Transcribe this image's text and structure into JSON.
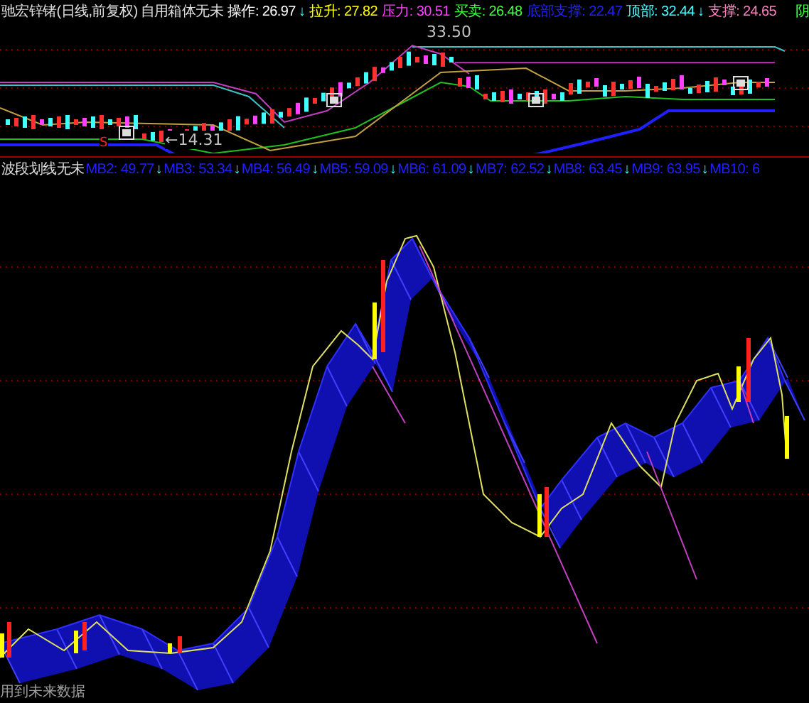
{
  "main_header": {
    "title": "驰宏锌锗(日线,前复权)",
    "formula": "自用箱体无未",
    "items": [
      {
        "label": "操作:",
        "value": "26.97",
        "color": "#ffffff",
        "arrow": "↓"
      },
      {
        "label": "拉升:",
        "value": "27.82",
        "color": "#ffff00"
      },
      {
        "label": "压力:",
        "value": "30.51",
        "color": "#ff40ff"
      },
      {
        "label": "买卖:",
        "value": "26.48",
        "color": "#40ff40"
      },
      {
        "label": "底部支撑:",
        "value": "22.47",
        "color": "#2020ff"
      },
      {
        "label": "顶部:",
        "value": "32.44",
        "color": "#40ffff",
        "arrow": "↓"
      },
      {
        "label": "支撑:",
        "value": "24.65",
        "color": "#ff80c0"
      }
    ],
    "tail": "阴"
  },
  "main_chart": {
    "high_label": "33.50",
    "low_label": "←14.31",
    "signal_mark": "S"
  },
  "indicator_header": {
    "title": "波段划线无未",
    "items": [
      {
        "text": "MB2: 49.77",
        "arrow": "↓"
      },
      {
        "text": "MB3: 53.34",
        "arrow": "↓"
      },
      {
        "text": "MB4: 56.49",
        "arrow": "↓"
      },
      {
        "text": "MB5: 59.09",
        "arrow": "↓"
      },
      {
        "text": "MB6: 61.09",
        "arrow": "↓"
      },
      {
        "text": "MB7: 62.52",
        "arrow": "↓"
      },
      {
        "text": "MB8: 63.45",
        "arrow": "↓"
      },
      {
        "text": "MB9: 63.95",
        "arrow": "↓"
      },
      {
        "text": "MB10: 6"
      }
    ]
  },
  "indicator_chart": {
    "note": "用到未来数据"
  }
}
